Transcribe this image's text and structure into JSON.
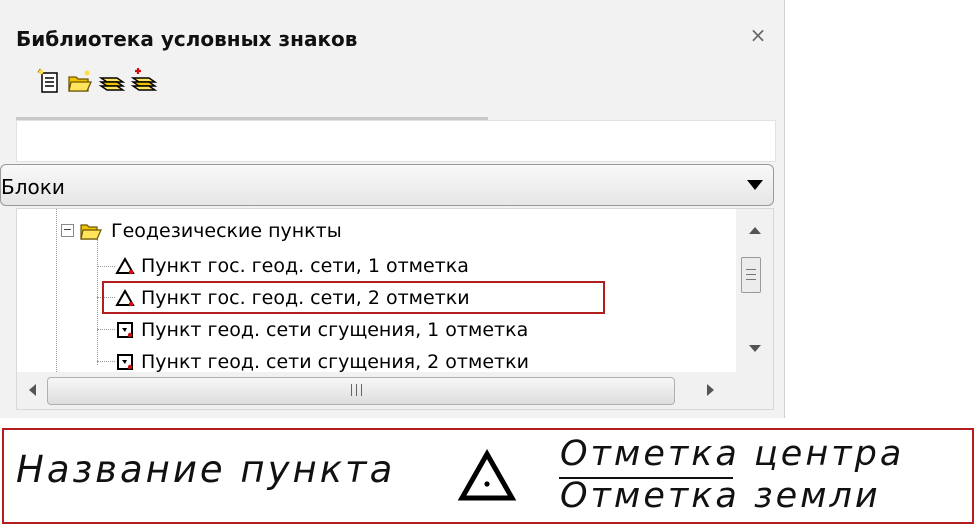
{
  "panel": {
    "title": "Библиотека условных знаков",
    "close_label": "×",
    "toolbar": [
      {
        "name": "new-library-icon"
      },
      {
        "name": "open-folder-icon"
      },
      {
        "name": "layers-icon"
      },
      {
        "name": "layers-add-icon"
      }
    ],
    "filter_value": "",
    "dropdown": {
      "selected": "Блоки"
    },
    "tree": {
      "group_label": "Геодезические пункты",
      "items": [
        {
          "label": "Пункт гос. геод. сети, 1 отметка",
          "icon": "triangle-symbol-icon"
        },
        {
          "label": "Пункт гос. геод. сети, 2 отметки",
          "icon": "triangle-symbol-icon"
        },
        {
          "label": "Пункт геод. сети сгущения, 1 отметка",
          "icon": "square-symbol-icon"
        },
        {
          "label": "Пункт геод. сети сгущения, 2 отметки",
          "icon": "square-symbol-icon"
        }
      ],
      "highlighted_index": 1
    }
  },
  "legend": {
    "name": "Название пункта",
    "top_mark": "Отметка центра",
    "bottom_mark": "Отметка земли"
  },
  "colors": {
    "highlight": "#b01e1e",
    "folder": "#f2c200"
  }
}
